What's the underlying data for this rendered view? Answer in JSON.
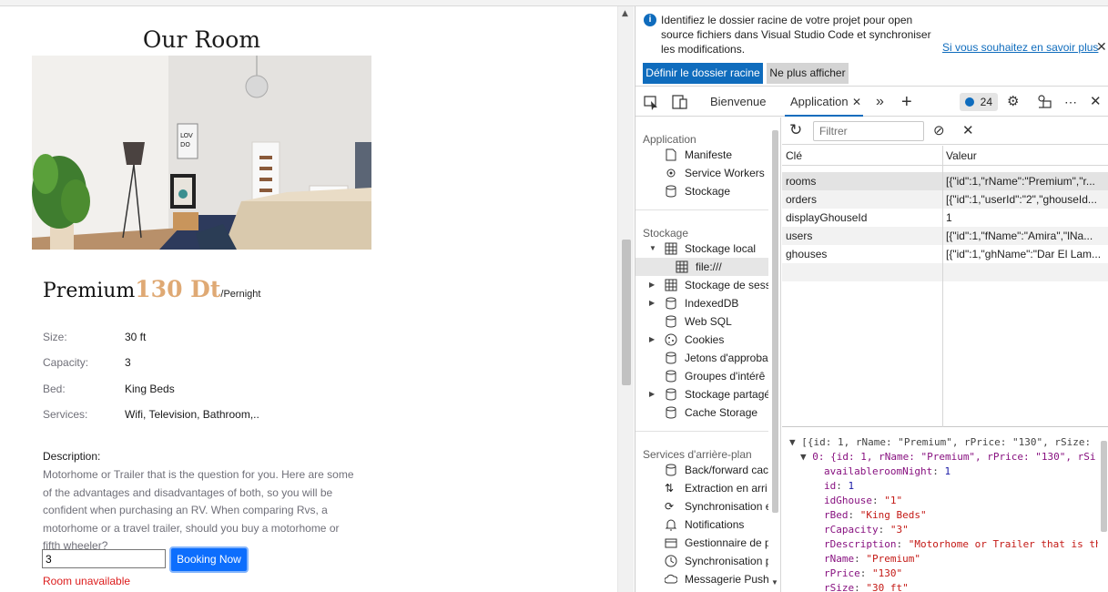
{
  "app": {
    "heading": "Our Room",
    "room": {
      "name": "Premium",
      "price": "130 Dt",
      "per": "/Pernight",
      "specs": [
        {
          "label": "Size:",
          "value": "30 ft"
        },
        {
          "label": "Capacity:",
          "value": "3"
        },
        {
          "label": "Bed:",
          "value": "King Beds"
        },
        {
          "label": "Services:",
          "value": "Wifi, Television, Bathroom,.."
        }
      ],
      "description_label": "Description:",
      "description": "Motorhome or Trailer that is the question for you. Here are some of the advantages and disadvantages of both, so you will be confident when purchasing an RV. When comparing Rvs, a motorhome or a travel trailer, should you buy a motorhome or fifth wheeler?"
    },
    "booking": {
      "nights_value": "3",
      "button_label": "Booking Now",
      "status": "Room unavailable"
    }
  },
  "devtools": {
    "infobar": {
      "text": "Identifiez le dossier racine de votre projet pour open source fichiers dans Visual Studio Code et synchroniser les modifications.",
      "link": "Si vous souhaitez en savoir plus",
      "primary_button": "Définir le dossier racine",
      "secondary_button": "Ne plus afficher"
    },
    "tabs": {
      "welcome": "Bienvenue",
      "application": "Application",
      "issues_count": "24"
    },
    "sidebar": {
      "section_application": "Application",
      "application_items": [
        "Manifeste",
        "Service Workers",
        "Stockage"
      ],
      "section_storage": "Stockage",
      "local_storage": "Stockage local",
      "local_storage_child": "file:///",
      "storage_items": [
        "Stockage de sess",
        "IndexedDB",
        "Web SQL",
        "Cookies",
        "Jetons d'approba",
        "Groupes d'intérê",
        "Stockage partagé",
        "Cache Storage"
      ],
      "section_background": "Services d'arrière-plan",
      "background_items": [
        "Back/forward cac",
        "Extraction en arri",
        "Synchronisation e",
        "Notifications",
        "Gestionnaire de p",
        "Synchronisation p",
        "Messagerie Push"
      ]
    },
    "storage": {
      "filter_placeholder": "Filtrer",
      "col_key": "Clé",
      "col_value": "Valeur",
      "rows": [
        {
          "key": "rooms",
          "value": "[{\"id\":1,\"rName\":\"Premium\",\"r..."
        },
        {
          "key": "orders",
          "value": "[{\"id\":1,\"userId\":\"2\",\"ghouseId..."
        },
        {
          "key": "displayGhouseId",
          "value": "1"
        },
        {
          "key": "users",
          "value": "[{\"id\":1,\"fName\":\"Amira\",\"lNa..."
        },
        {
          "key": "ghouses",
          "value": "[{\"id\":1,\"ghName\":\"Dar El Lam..."
        }
      ]
    },
    "preview": {
      "root": "[{id: 1, rName: \"Premium\", rPrice: \"130\", rSize:",
      "item0": "0: {id: 1, rName: \"Premium\", rPrice: \"130\", rSi",
      "props": [
        {
          "k": "availableroomNight",
          "v": "1",
          "type": "num"
        },
        {
          "k": "id",
          "v": "1",
          "type": "num"
        },
        {
          "k": "idGhouse",
          "v": "\"1\"",
          "type": "str"
        },
        {
          "k": "rBed",
          "v": "\"King Beds\"",
          "type": "str"
        },
        {
          "k": "rCapacity",
          "v": "\"3\"",
          "type": "str"
        },
        {
          "k": "rDescription",
          "v": "\"Motorhome or Trailer that is th",
          "type": "str"
        },
        {
          "k": "rName",
          "v": "\"Premium\"",
          "type": "str"
        },
        {
          "k": "rPrice",
          "v": "\"130\"",
          "type": "str"
        },
        {
          "k": "rSize",
          "v": "\"30 ft\"",
          "type": "str"
        }
      ]
    }
  }
}
